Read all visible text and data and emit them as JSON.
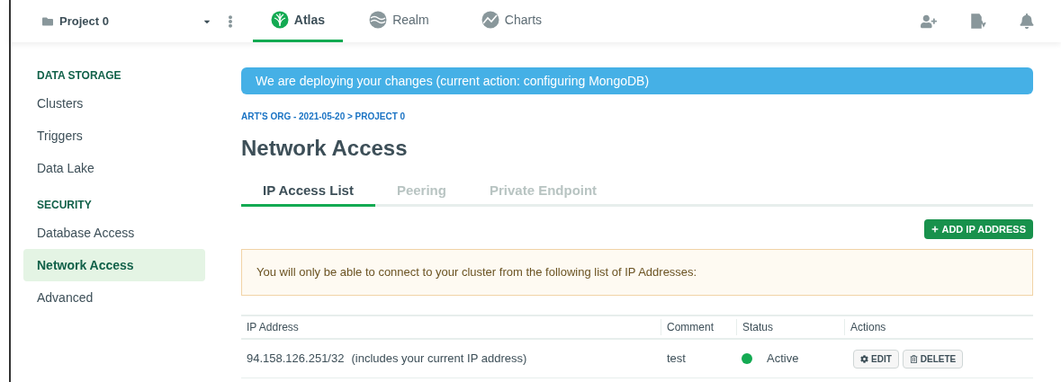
{
  "project": {
    "name": "Project 0"
  },
  "products": [
    {
      "label": "Atlas",
      "selected": true
    },
    {
      "label": "Realm",
      "selected": false
    },
    {
      "label": "Charts",
      "selected": false
    }
  ],
  "sidebar": {
    "sections": [
      {
        "title": "DATA STORAGE",
        "items": [
          {
            "label": "Clusters",
            "selected": false
          },
          {
            "label": "Triggers",
            "selected": false
          },
          {
            "label": "Data Lake",
            "selected": false
          }
        ]
      },
      {
        "title": "SECURITY",
        "items": [
          {
            "label": "Database Access",
            "selected": false
          },
          {
            "label": "Network Access",
            "selected": true
          },
          {
            "label": "Advanced",
            "selected": false
          }
        ]
      }
    ]
  },
  "banner": "We are deploying your changes (current action: configuring MongoDB)",
  "breadcrumb": "ART'S ORG - 2021-05-20 > PROJECT 0",
  "title": "Network Access",
  "tabs": [
    {
      "label": "IP Access List",
      "selected": true
    },
    {
      "label": "Peering",
      "selected": false
    },
    {
      "label": "Private Endpoint",
      "selected": false
    }
  ],
  "add_button": "ADD IP ADDRESS",
  "notice": "You will only be able to connect to your cluster from the following list of IP Addresses:",
  "table": {
    "columns": [
      "IP Address",
      "Comment",
      "Status",
      "Actions"
    ],
    "rows": [
      {
        "ip": "94.158.126.251/32",
        "note": "(includes your current IP address)",
        "comment": "test",
        "status": "Active",
        "color": "#13aa52",
        "actions": [
          "EDIT",
          "DELETE"
        ]
      }
    ]
  }
}
